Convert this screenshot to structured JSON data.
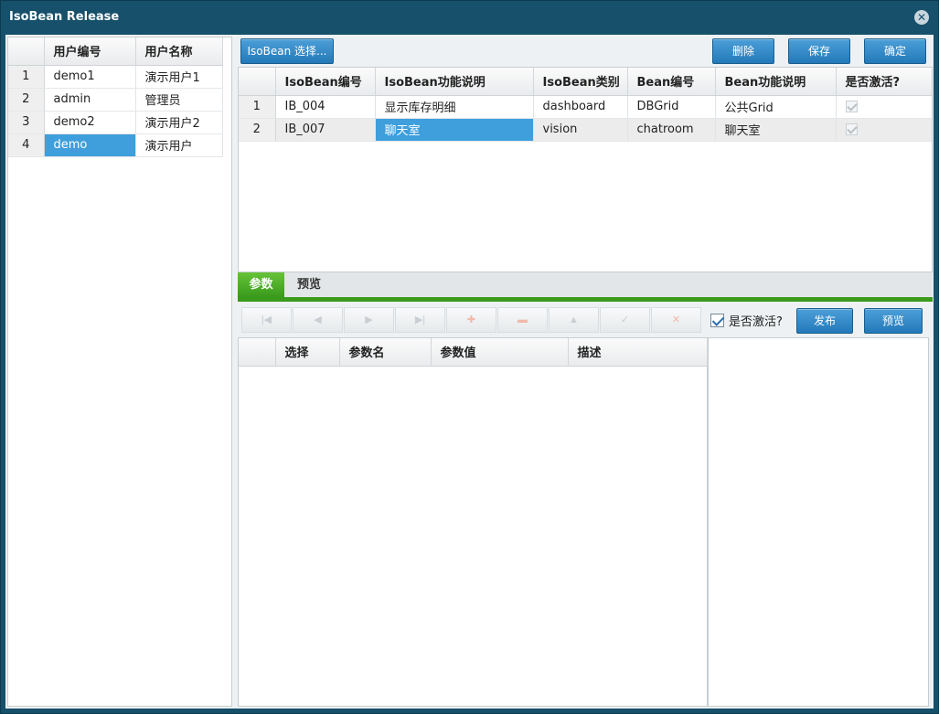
{
  "window": {
    "title": "IsoBean Release"
  },
  "users": {
    "headers": [
      "用户编号",
      "用户名称"
    ],
    "rows": [
      {
        "no": "1",
        "id": "demo1",
        "name": "演示用户1"
      },
      {
        "no": "2",
        "id": "admin",
        "name": "管理员"
      },
      {
        "no": "3",
        "id": "demo2",
        "name": "演示用户2"
      },
      {
        "no": "4",
        "id": "demo",
        "name": "演示用户"
      }
    ]
  },
  "toolbar": {
    "select_label": "IsoBean 选择...",
    "delete_label": "删除",
    "save_label": "保存",
    "ok_label": "确定"
  },
  "beans": {
    "headers": [
      "IsoBean编号",
      "IsoBean功能说明",
      "IsoBean类别",
      "Bean编号",
      "Bean功能说明",
      "是否激活?"
    ],
    "rows": [
      {
        "no": "1",
        "id": "IB_004",
        "desc": "显示库存明细",
        "type": "dashboard",
        "bean_id": "DBGrid",
        "bean_desc": "公共Grid",
        "active": true
      },
      {
        "no": "2",
        "id": "IB_007",
        "desc": "聊天室",
        "type": "vision",
        "bean_id": "chatroom",
        "bean_desc": "聊天室",
        "active": true
      }
    ]
  },
  "tabs": {
    "params": "参数",
    "preview": "预览"
  },
  "navigator": {
    "active_label": "是否激活?",
    "publish_label": "发布",
    "preview_label": "预览"
  },
  "params": {
    "headers": [
      "选择",
      "参数名",
      "参数值",
      "描述"
    ]
  },
  "colors": {
    "selection": "#3e9fdc",
    "tab_active": "#3a9a1c",
    "title_bar": "#17506b"
  }
}
